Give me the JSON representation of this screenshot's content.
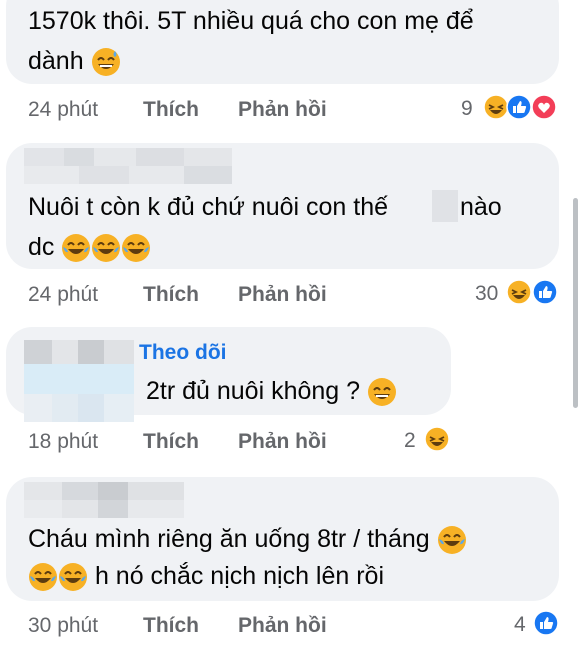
{
  "comments": [
    {
      "text_lines": [
        "1570k thôi. 5T nhiều quá cho con mẹ để",
        "dành"
      ],
      "time": "24 phút",
      "like": "Thích",
      "reply": "Phản hồi",
      "reaction_count": "9",
      "reactions": [
        "haha",
        "like",
        "love"
      ]
    },
    {
      "text_lines": [
        "Nuôi t còn k đủ chứ nuôi con thế",
        "nào",
        "dc"
      ],
      "time": "24 phút",
      "like": "Thích",
      "reply": "Phản hồi",
      "reaction_count": "30",
      "reactions": [
        "haha",
        "like"
      ]
    },
    {
      "follow": "Theo dõi",
      "text_lines": [
        "2tr đủ nuôi không ?"
      ],
      "time": "18 phút",
      "like": "Thích",
      "reply": "Phản hồi",
      "reaction_count": "2",
      "reactions": [
        "haha"
      ]
    },
    {
      "text_lines": [
        "Cháu mình riêng ăn uống 8tr / tháng",
        "h nó chắc nịch nịch lên rồi"
      ],
      "time": "30 phút",
      "like": "Thích",
      "reply": "Phản hồi",
      "reaction_count": "4",
      "reactions": [
        "like"
      ]
    }
  ],
  "colors": {
    "bubble": "#f0f2f5",
    "meta_text": "#65676b",
    "link_blue": "#1b74e4",
    "like_blue": "#1877f2",
    "love_red": "#f33e58",
    "haha_yellow": "#f7b125"
  }
}
